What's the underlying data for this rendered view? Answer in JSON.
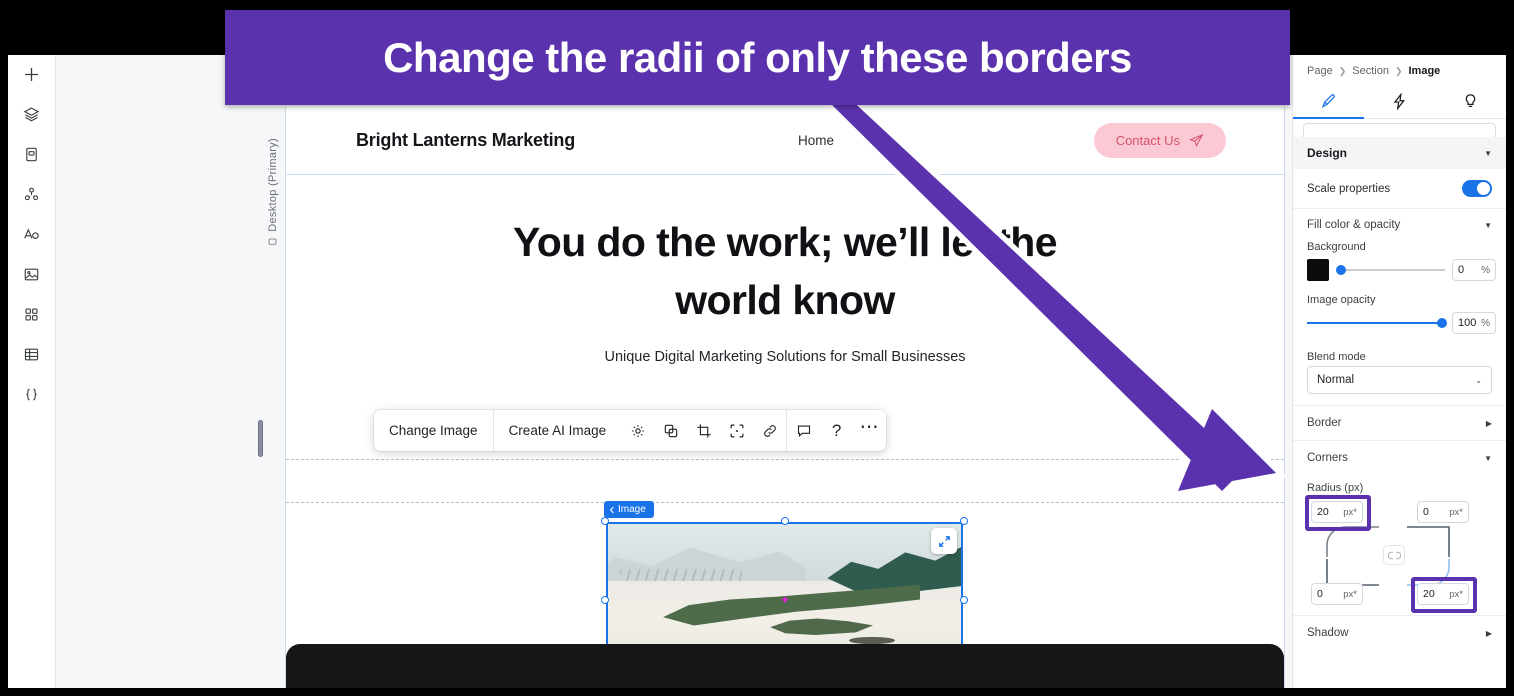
{
  "annotation": {
    "banner_text": "Change the radii of only these borders",
    "banner_color": "#5b32ae",
    "arrow_color": "#5b32ae"
  },
  "left_rail": {
    "items": [
      {
        "name": "add-icon",
        "label": "Add"
      },
      {
        "name": "layers-icon",
        "label": "Layers"
      },
      {
        "name": "page-icon",
        "label": "Pages"
      },
      {
        "name": "components-icon",
        "label": "Components"
      },
      {
        "name": "text-icon",
        "label": "Text"
      },
      {
        "name": "image-icon",
        "label": "Image"
      },
      {
        "name": "apps-icon",
        "label": "Apps"
      },
      {
        "name": "table-icon",
        "label": "Table"
      },
      {
        "name": "code-icon",
        "label": "Code"
      }
    ]
  },
  "canvas": {
    "device_label": "Desktop (Primary)",
    "site": {
      "brand": "Bright Lanterns Marketing",
      "nav_home": "Home",
      "contact_button": "Contact Us",
      "hero_title": "You do the work; we’ll let the world know",
      "hero_subtitle": "Unique Digital Marketing Solutions for Small Businesses"
    },
    "selection_tag": "Image"
  },
  "image_toolbar": {
    "change_image": "Change Image",
    "create_ai_image": "Create AI Image",
    "icons": [
      {
        "name": "gear-icon",
        "label": "Settings"
      },
      {
        "name": "duplicate-icon",
        "label": "Duplicate"
      },
      {
        "name": "crop-icon",
        "label": "Crop"
      },
      {
        "name": "fit-icon",
        "label": "Fit"
      },
      {
        "name": "link-icon",
        "label": "Link"
      },
      {
        "name": "comment-icon",
        "label": "Comment"
      },
      {
        "name": "help-icon",
        "label": "?"
      },
      {
        "name": "more-icon",
        "label": "⋯"
      }
    ]
  },
  "panel": {
    "breadcrumb": {
      "page": "Page",
      "section": "Section",
      "current": "Image"
    },
    "tabs": [
      {
        "name": "design-tab",
        "icon": "paintbrush-icon",
        "active": true
      },
      {
        "name": "interactions-tab",
        "icon": "lightning-icon",
        "active": false
      },
      {
        "name": "insights-tab",
        "icon": "lightbulb-icon",
        "active": false
      }
    ],
    "design_section": "Design",
    "scale_properties_label": "Scale properties",
    "scale_properties_on": true,
    "fill_section": "Fill color & opacity",
    "background_label": "Background",
    "background_color": "#0b0b0c",
    "background_opacity": "0",
    "background_opacity_unit": "%",
    "image_opacity_label": "Image opacity",
    "image_opacity": "100",
    "image_opacity_unit": "%",
    "blend_mode_label": "Blend mode",
    "blend_mode_value": "Normal",
    "border_section": "Border",
    "corners_section": "Corners",
    "radius_label": "Radius (px)",
    "radius": {
      "top_left": "20",
      "top_right": "0",
      "bottom_left": "0",
      "bottom_right": "20",
      "unit": "px*"
    },
    "shadow_section": "Shadow"
  }
}
